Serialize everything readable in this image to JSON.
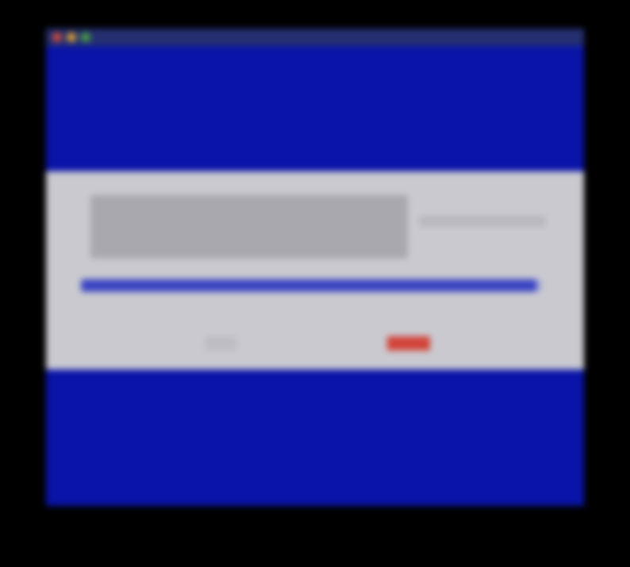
{
  "window": {
    "title": "",
    "subtitle": ""
  },
  "dialog": {
    "logo_text": "",
    "progress": 0.99,
    "left_button_label": "",
    "right_button_label": ""
  },
  "footer": {
    "text": ""
  },
  "colors": {
    "background": "#0a14a8",
    "dialog": "#c9c9cf",
    "progress": "#3b45c4",
    "accent_button": "#d3443a"
  }
}
